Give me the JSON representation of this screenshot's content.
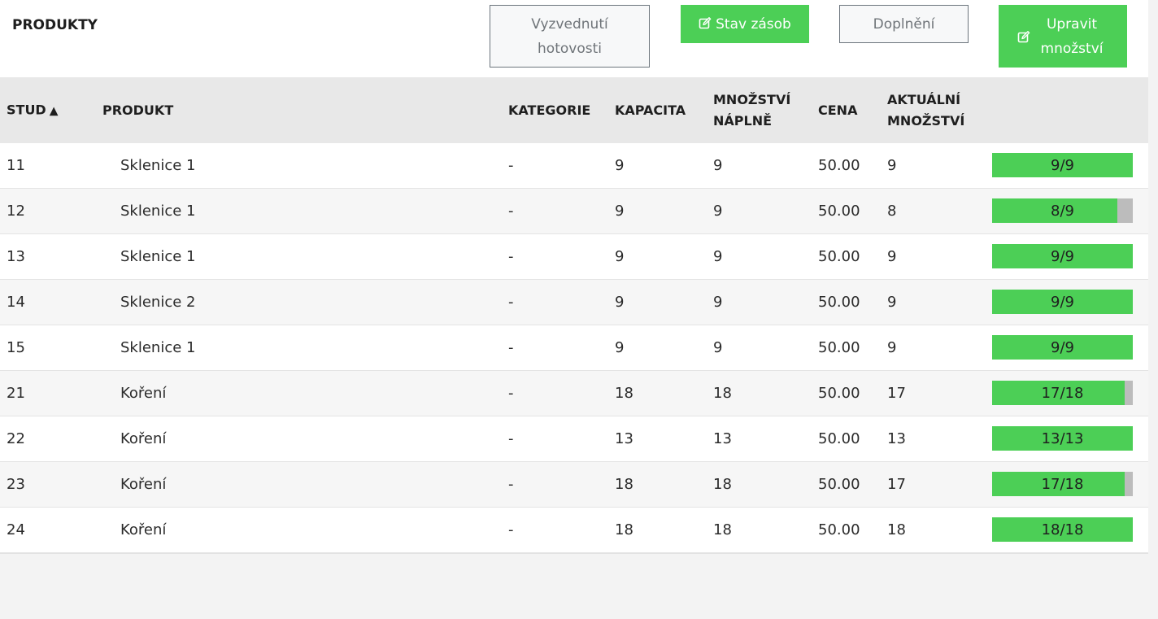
{
  "header": {
    "title": "PRODUKTY",
    "buttons": {
      "withdraw_cash": "Vyzvednutí hotovosti",
      "stock_status": "Stav zásob",
      "refill": "Doplnění",
      "edit_quantity": "Upravit množství"
    }
  },
  "colors": {
    "accent_green": "#4ccf56",
    "bar_empty": "#bcbcbc",
    "header_bg": "#e8e8e8"
  },
  "table": {
    "columns": {
      "stud": "STUD",
      "stud_sort_indicator": "▲",
      "produkt": "PRODUKT",
      "kategorie": "KATEGORIE",
      "kapacita": "KAPACITA",
      "mnozstvi_naplne_1": "MNOŽSTVÍ",
      "mnozstvi_naplne_2": "NÁPLNĚ",
      "cena": "CENA",
      "aktualni_mnozstvi_1": "AKTUÁLNÍ",
      "aktualni_mnozstvi_2": "MNOŽSTVÍ"
    },
    "rows": [
      {
        "stud": "11",
        "produkt": "Sklenice 1",
        "kategorie": "-",
        "kapacita": "9",
        "mnozstvi_naplne": "9",
        "cena": "50.00",
        "aktualni": "9",
        "fill": 1.0,
        "bar_label": "9/9"
      },
      {
        "stud": "12",
        "produkt": "Sklenice 1",
        "kategorie": "-",
        "kapacita": "9",
        "mnozstvi_naplne": "9",
        "cena": "50.00",
        "aktualni": "8",
        "fill": 0.8889,
        "bar_label": "8/9"
      },
      {
        "stud": "13",
        "produkt": "Sklenice 1",
        "kategorie": "-",
        "kapacita": "9",
        "mnozstvi_naplne": "9",
        "cena": "50.00",
        "aktualni": "9",
        "fill": 1.0,
        "bar_label": "9/9"
      },
      {
        "stud": "14",
        "produkt": "Sklenice 2",
        "kategorie": "-",
        "kapacita": "9",
        "mnozstvi_naplne": "9",
        "cena": "50.00",
        "aktualni": "9",
        "fill": 1.0,
        "bar_label": "9/9"
      },
      {
        "stud": "15",
        "produkt": "Sklenice 1",
        "kategorie": "-",
        "kapacita": "9",
        "mnozstvi_naplne": "9",
        "cena": "50.00",
        "aktualni": "9",
        "fill": 1.0,
        "bar_label": "9/9"
      },
      {
        "stud": "21",
        "produkt": "Koření",
        "kategorie": "-",
        "kapacita": "18",
        "mnozstvi_naplne": "18",
        "cena": "50.00",
        "aktualni": "17",
        "fill": 0.9444,
        "bar_label": "17/18"
      },
      {
        "stud": "22",
        "produkt": "Koření",
        "kategorie": "-",
        "kapacita": "13",
        "mnozstvi_naplne": "13",
        "cena": "50.00",
        "aktualni": "13",
        "fill": 1.0,
        "bar_label": "13/13"
      },
      {
        "stud": "23",
        "produkt": "Koření",
        "kategorie": "-",
        "kapacita": "18",
        "mnozstvi_naplne": "18",
        "cena": "50.00",
        "aktualni": "17",
        "fill": 0.9444,
        "bar_label": "17/18"
      },
      {
        "stud": "24",
        "produkt": "Koření",
        "kategorie": "-",
        "kapacita": "18",
        "mnozstvi_naplne": "18",
        "cena": "50.00",
        "aktualni": "18",
        "fill": 1.0,
        "bar_label": "18/18"
      }
    ]
  }
}
